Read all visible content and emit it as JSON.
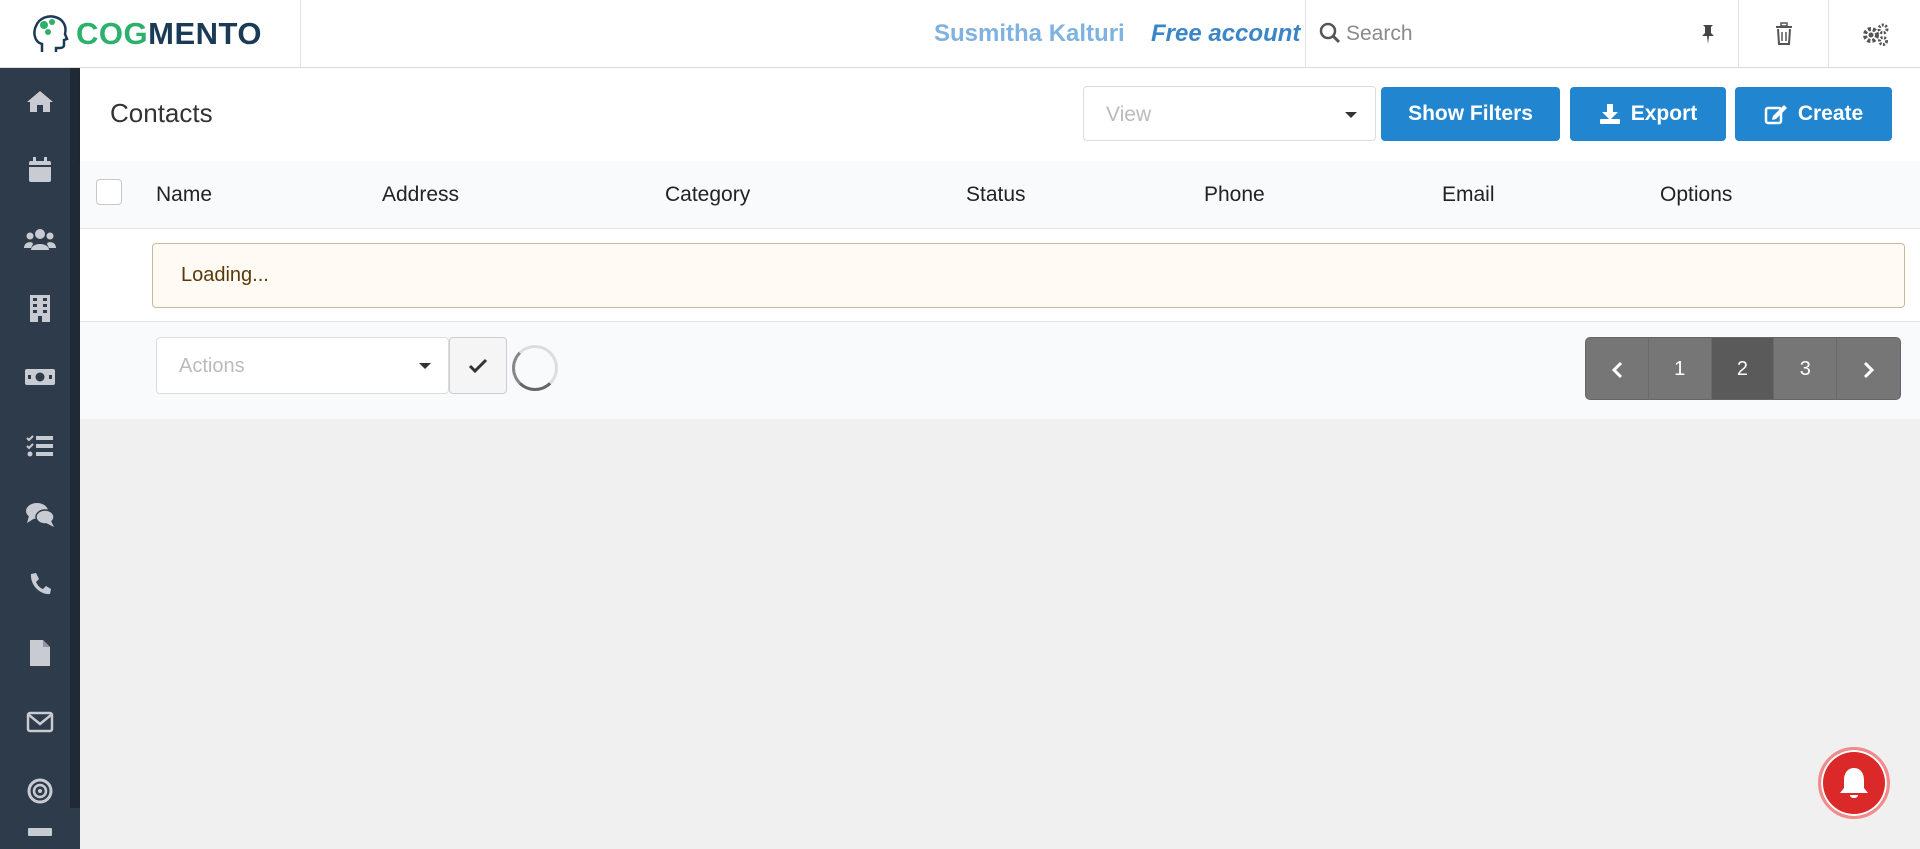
{
  "topbar": {
    "logo": {
      "part1": "COG",
      "part2": "MENTO"
    },
    "user_name": "Susmitha Kalturi",
    "account": "Free account",
    "search_placeholder": "Search"
  },
  "sidebar": {
    "items": [
      {
        "name": "home",
        "icon": "home-icon"
      },
      {
        "name": "calendar",
        "icon": "calendar-icon"
      },
      {
        "name": "contacts",
        "icon": "users-icon"
      },
      {
        "name": "companies",
        "icon": "building-icon"
      },
      {
        "name": "deals",
        "icon": "money-icon"
      },
      {
        "name": "tasks",
        "icon": "tasks-icon"
      },
      {
        "name": "cases",
        "icon": "comments-icon"
      },
      {
        "name": "calls",
        "icon": "phone-icon"
      },
      {
        "name": "documents",
        "icon": "file-icon"
      },
      {
        "name": "email",
        "icon": "envelope-icon"
      },
      {
        "name": "campaigns",
        "icon": "bullseye-icon"
      }
    ]
  },
  "header": {
    "title": "Contacts",
    "view_placeholder": "View",
    "show_filters": "Show Filters",
    "export": "Export",
    "create": "Create"
  },
  "table": {
    "columns": [
      "Name",
      "Address",
      "Category",
      "Status",
      "Phone",
      "Email",
      "Options"
    ],
    "loading_text": "Loading...",
    "actions_placeholder": "Actions"
  },
  "pagination": {
    "pages": [
      "1",
      "2",
      "3"
    ],
    "current": "2"
  },
  "colors": {
    "primary": "#2185d0",
    "sidebar": "#2e3b4a",
    "logo_green": "#2db06b",
    "logo_navy": "#1a3a56",
    "notification": "#db2828"
  }
}
